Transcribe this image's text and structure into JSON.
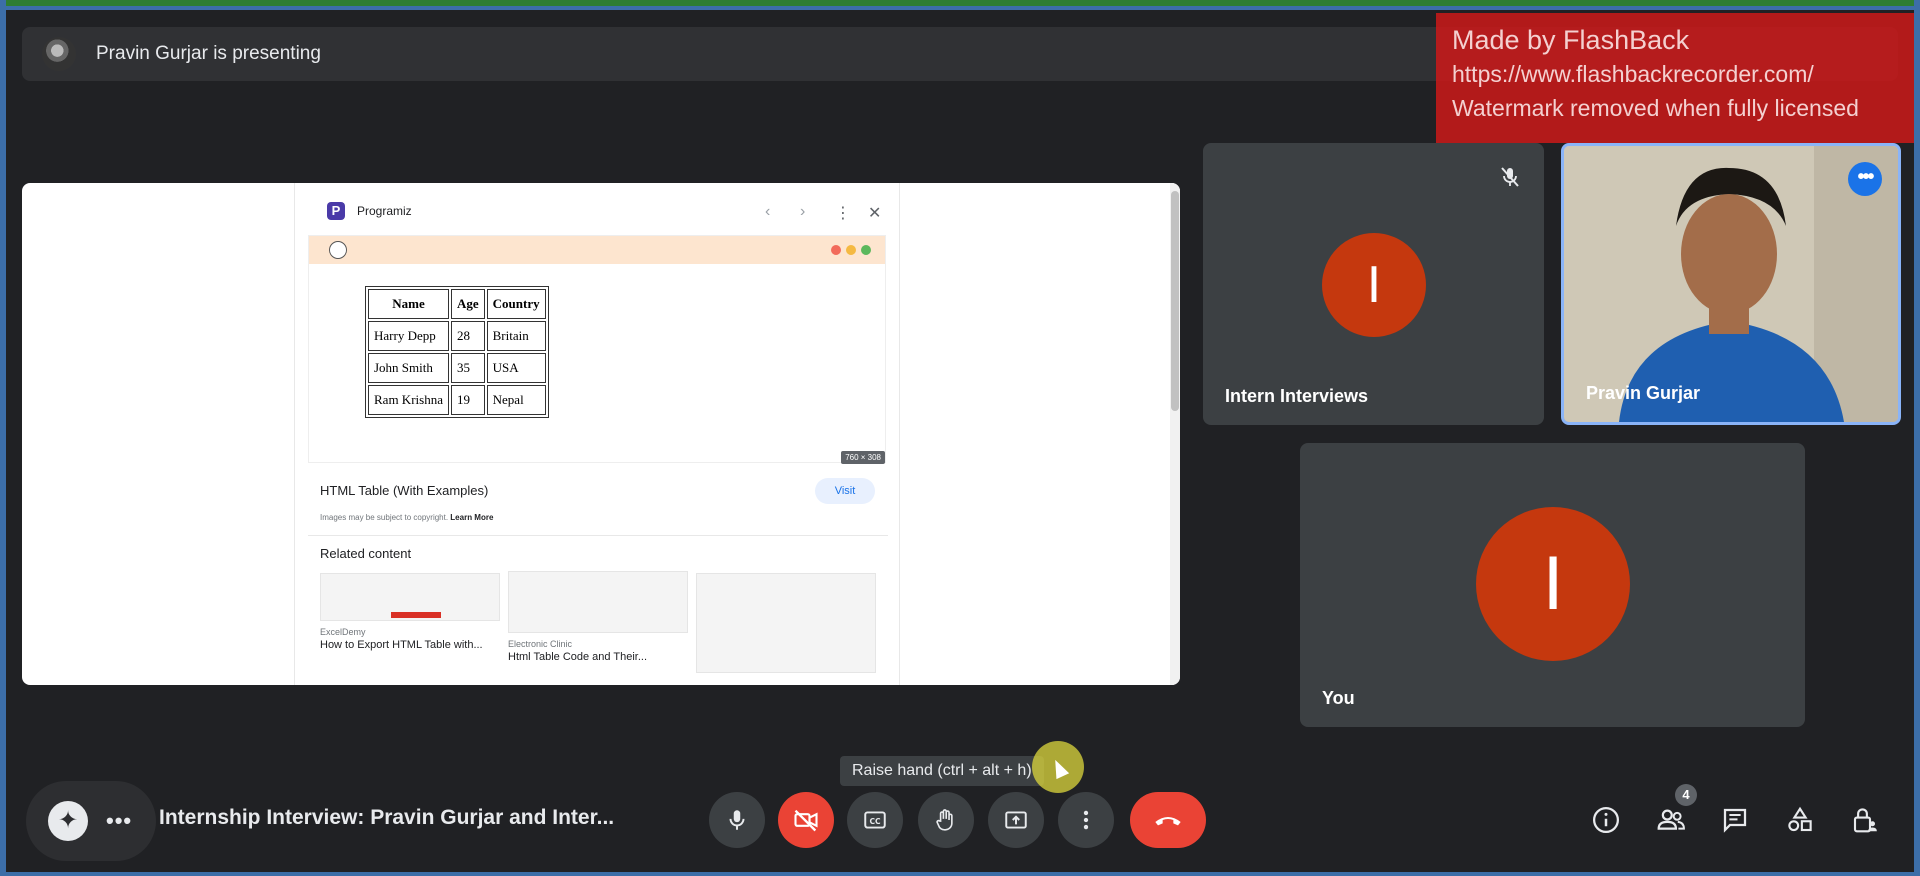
{
  "presenting": {
    "text": "Pravin Gurjar is presenting"
  },
  "watermark": {
    "line1": "Made by FlashBack",
    "line2": "https://www.flashbackrecorder.com/",
    "line3": "Watermark removed when fully licensed"
  },
  "shared_screen": {
    "site_name": "Programiz",
    "preview_table": {
      "headers": [
        "Name",
        "Age",
        "Country"
      ],
      "rows": [
        [
          "Harry Depp",
          "28",
          "Britain"
        ],
        [
          "John Smith",
          "35",
          "USA"
        ],
        [
          "Ram Krishna",
          "19",
          "Nepal"
        ]
      ]
    },
    "image_size": "760 × 308",
    "result_title": "HTML Table (With Examples)",
    "visit_label": "Visit",
    "copyright_text": "Images may be subject to copyright.",
    "learn_more": "Learn More",
    "related_heading": "Related content",
    "related": [
      {
        "source": "ExcelDemy",
        "title": "How to Export HTML Table with..."
      },
      {
        "source": "Electronic Clinic",
        "title": "Html Table Code and Their..."
      },
      {
        "source": "",
        "title": ""
      }
    ],
    "dot_colors": [
      "#f26b5b",
      "#f5b942",
      "#5cb85c"
    ]
  },
  "participants": [
    {
      "name": "Intern Interviews",
      "initial": "I",
      "muted": true
    },
    {
      "name": "Pravin Gurjar",
      "video": true
    },
    {
      "name": "You",
      "initial": "I"
    }
  ],
  "tooltip": "Raise hand (ctrl + alt + h)",
  "meeting_title": "Internship Interview: Pravin Gurjar and Inter...",
  "people_count": "4",
  "colors": {
    "accent": "#8ab4f8",
    "danger": "#ea4335",
    "avatar": "#c5380e"
  }
}
